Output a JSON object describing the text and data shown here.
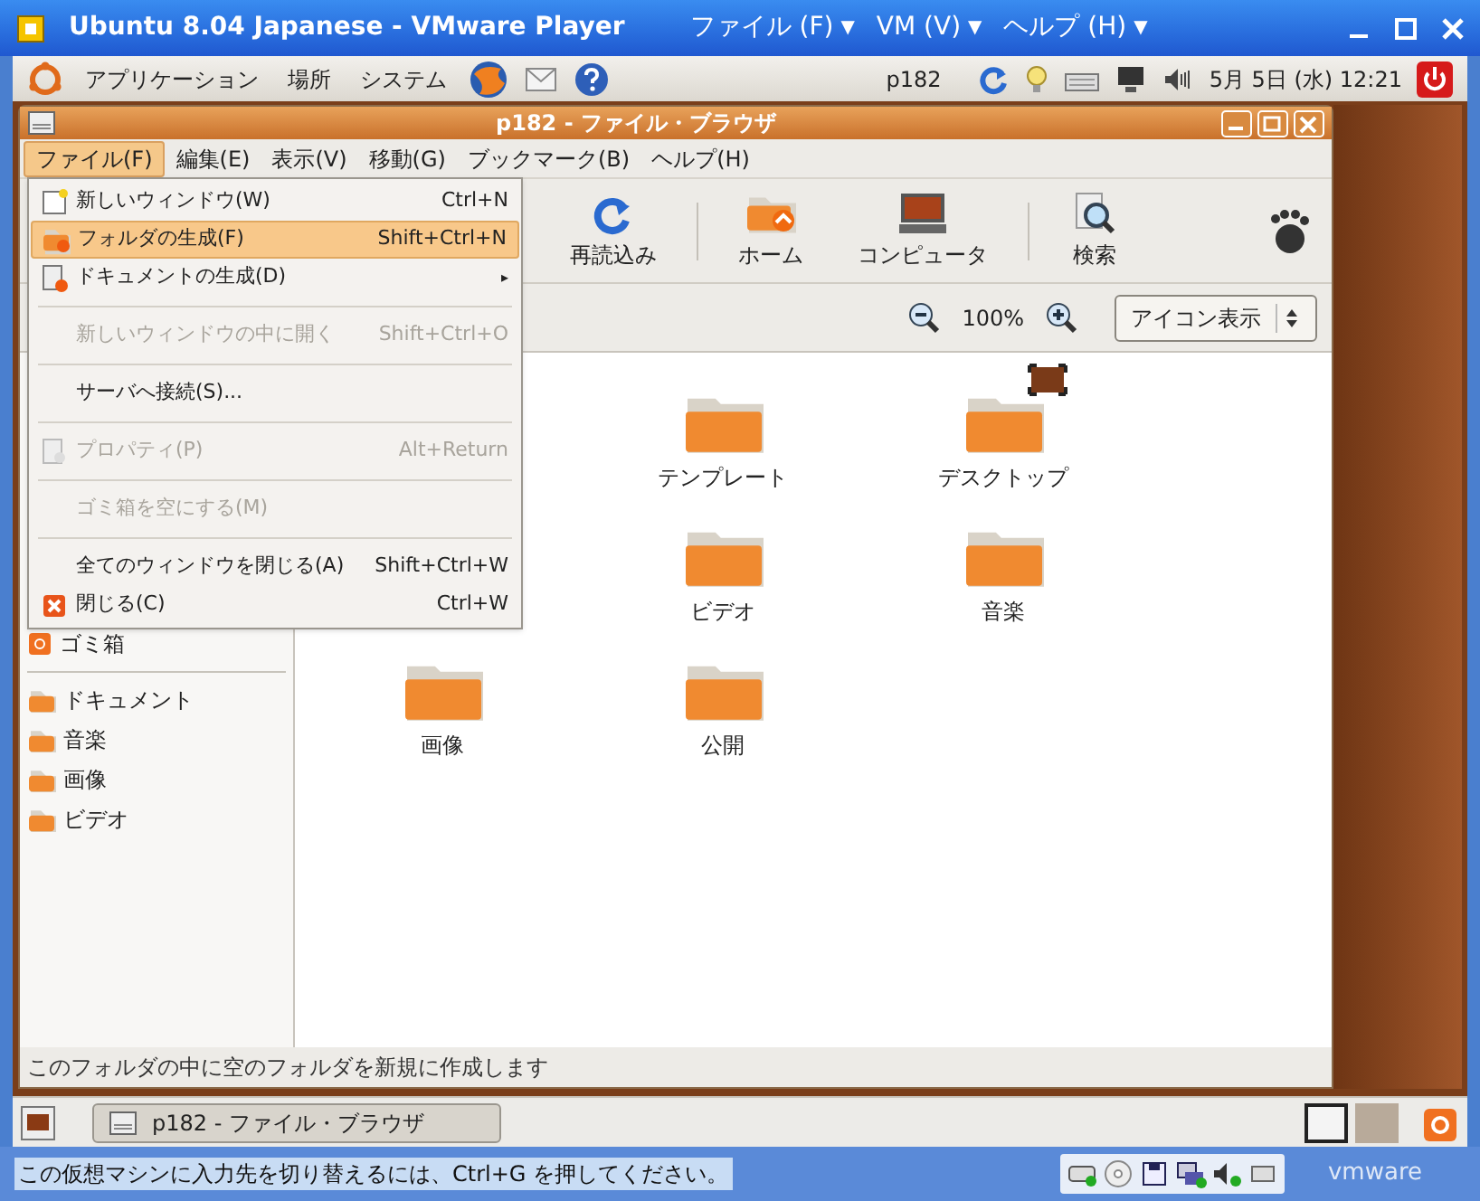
{
  "vm_window": {
    "title": "Ubuntu 8.04 Japanese - VMware Player",
    "menus": [
      {
        "label": "ファイル (F)",
        "arrow": "▼"
      },
      {
        "label": "VM (V)",
        "arrow": "▼"
      },
      {
        "label": "ヘルプ (H)",
        "arrow": "▼"
      }
    ]
  },
  "top_panel": {
    "menus": [
      "アプリケーション",
      "場所",
      "システム"
    ],
    "user": "p182",
    "clock": "5月 5日 (水) 12:21"
  },
  "browser": {
    "title": "p182 - ファイル・ブラウザ",
    "menubar": [
      {
        "label": "ファイル(F)",
        "selected": true
      },
      {
        "label": "編集(E)",
        "selected": false
      },
      {
        "label": "表示(V)",
        "selected": false
      },
      {
        "label": "移動(G)",
        "selected": false
      },
      {
        "label": "ブックマーク(B)",
        "selected": false
      },
      {
        "label": "ヘルプ(H)",
        "selected": false
      }
    ],
    "toolbar": [
      {
        "kind": "reload",
        "label": "再読込み"
      },
      {
        "kind": "separator"
      },
      {
        "kind": "home",
        "label": "ホーム"
      },
      {
        "kind": "computer",
        "label": "コンピュータ"
      },
      {
        "kind": "separator"
      },
      {
        "kind": "search",
        "label": "検索"
      }
    ],
    "zoom": "100%",
    "view_mode": "アイコン表示",
    "sidebar": [
      {
        "label": "ゴミ箱",
        "kind": "trash"
      },
      {
        "kind": "divider"
      },
      {
        "label": "ドキュメント",
        "kind": "folder"
      },
      {
        "label": "音楽",
        "kind": "folder"
      },
      {
        "label": "画像",
        "kind": "folder"
      },
      {
        "label": "ビデオ",
        "kind": "folder"
      }
    ],
    "icons": [
      "テンプレート",
      "デスクトップ",
      "ビデオ",
      "音楽",
      "画像",
      "公開"
    ],
    "status": "このフォルダの中に空のフォルダを新規に作成します",
    "file_menu": [
      {
        "kind": "window",
        "label": "新しいウィンドウ(W)",
        "shortcut": "Ctrl+N",
        "disabled": false,
        "selected": false
      },
      {
        "kind": "folder",
        "label": "フォルダの生成(F)",
        "shortcut": "Shift+Ctrl+N",
        "disabled": false,
        "selected": true
      },
      {
        "kind": "document",
        "label": "ドキュメントの生成(D)",
        "arrow": "▸",
        "disabled": false,
        "selected": false
      },
      {
        "kind": "separator"
      },
      {
        "kind": "plain",
        "label": "新しいウィンドウの中に開く",
        "shortcut": "Shift+Ctrl+O",
        "disabled": true,
        "selected": false
      },
      {
        "kind": "separator"
      },
      {
        "kind": "plain",
        "label": "サーバへ接続(S)...",
        "disabled": false,
        "selected": false
      },
      {
        "kind": "separator"
      },
      {
        "kind": "properties",
        "label": "プロパティ(P)",
        "shortcut": "Alt+Return",
        "disabled": true,
        "selected": false
      },
      {
        "kind": "separator"
      },
      {
        "kind": "plain",
        "label": "ゴミ箱を空にする(M)",
        "disabled": true,
        "selected": false
      },
      {
        "kind": "separator"
      },
      {
        "kind": "plain",
        "label": "全てのウィンドウを閉じる(A)",
        "shortcut": "Shift+Ctrl+W",
        "disabled": false,
        "selected": false
      },
      {
        "kind": "close",
        "label": "閉じる(C)",
        "shortcut": "Ctrl+W",
        "disabled": false,
        "selected": false
      }
    ]
  },
  "bottom_panel": {
    "task": "p182 - ファイル・ブラウザ",
    "workspaces": [
      {
        "selected": true
      },
      {
        "selected": false
      }
    ]
  },
  "vm_status": {
    "message": "この仮想マシンに入力先を切り替えるには、Ctrl+G を押してください。",
    "brand": "vmware"
  }
}
